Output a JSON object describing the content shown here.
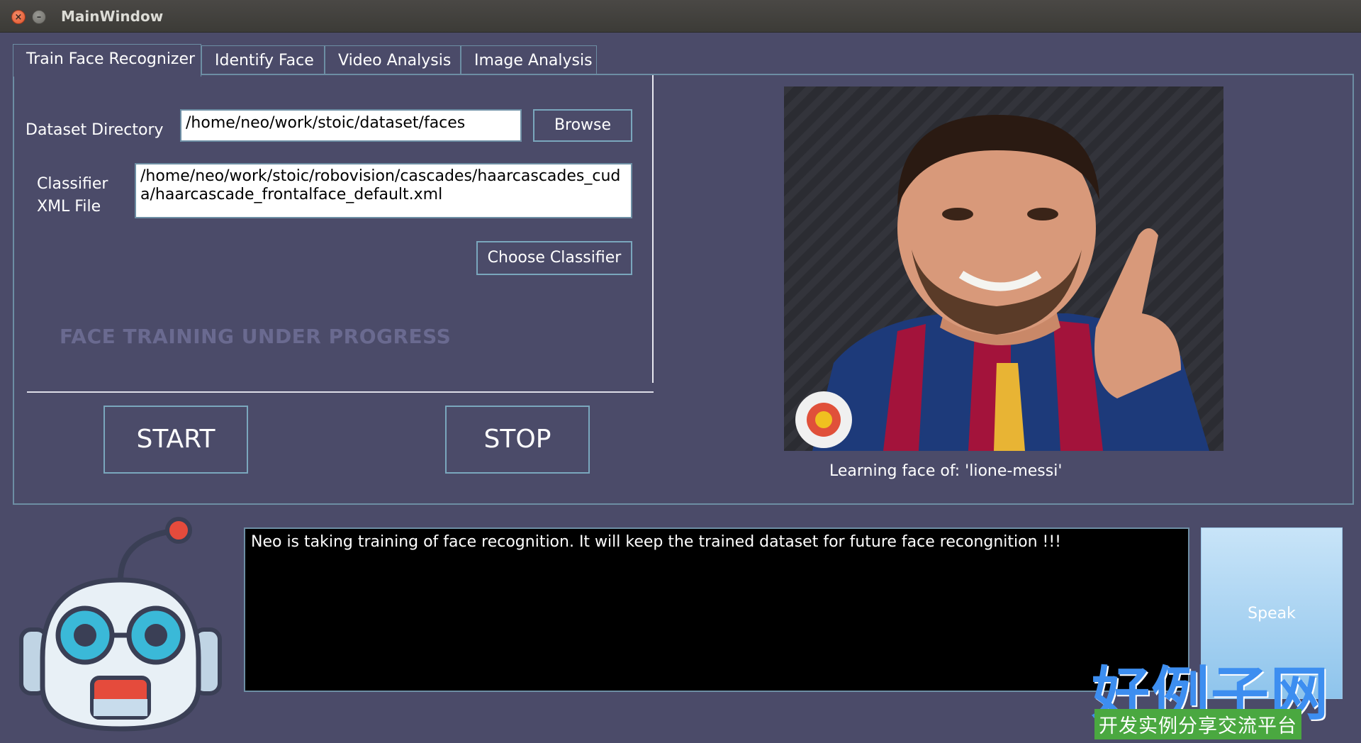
{
  "window": {
    "title": "MainWindow"
  },
  "tabs": [
    {
      "label": "Train Face Recognizer",
      "active": true
    },
    {
      "label": "Identify Face",
      "active": false
    },
    {
      "label": "Video Analysis",
      "active": false
    },
    {
      "label": "Image Analysis",
      "active": false
    }
  ],
  "train": {
    "dataset_label": "Dataset Directory",
    "dataset_value": "/home/neo/work/stoic/dataset/faces",
    "browse_label": "Browse",
    "classifier_label_line1": "Classifier",
    "classifier_label_line2": "XML File",
    "classifier_value": "/home/neo/work/stoic/robovision/cascades/haarcascades_cuda/haarcascade_frontalface_default.xml",
    "choose_classifier_label": "Choose Classifier",
    "progress_text": "FACE TRAINING UNDER PROGRESS",
    "start_label": "START",
    "stop_label": "STOP",
    "caption": "Learning face of: 'lione-messi'"
  },
  "console": {
    "text": "Neo is taking training of face recognition. It will keep the trained dataset for future face recongnition !!!"
  },
  "speak": {
    "label": "Speak"
  },
  "watermark": {
    "main": "好例子网",
    "sub": "开发实例分享交流平台"
  },
  "colors": {
    "background": "#4b4b69",
    "border": "#6d8ea4",
    "accent": "#8ec4ec"
  }
}
